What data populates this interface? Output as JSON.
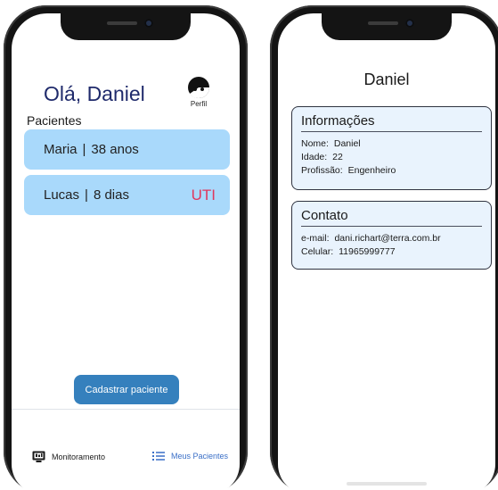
{
  "left_screen": {
    "greeting": "Olá, Daniel",
    "profile_label": "Perfil",
    "section_title": "Pacientes",
    "patients": [
      {
        "name": "Maria",
        "separator": "|",
        "age": "38  anos",
        "tag": ""
      },
      {
        "name": "Lucas",
        "separator": "|",
        "age": "8  dias",
        "tag": "UTI"
      }
    ],
    "register_button": "Cadastrar paciente",
    "nav": {
      "monitoring": {
        "label": "Monitoramento",
        "icon": "monitor-icon"
      },
      "my_patients": {
        "label": "Meus Pacientes",
        "icon": "list-icon"
      }
    }
  },
  "right_screen": {
    "title": "Daniel",
    "info": {
      "title": "Informações",
      "name_label": "Nome:",
      "name_value": "Daniel",
      "age_label": "Idade:",
      "age_value": "22",
      "profession_label": "Profissão:",
      "profession_value": "Engenheiro"
    },
    "contact": {
      "title": "Contato",
      "email_label": "e-mail:",
      "email_value": "dani.richart@terra.com.br",
      "phone_label": "Celular:",
      "phone_value": "11965999777"
    }
  },
  "colors": {
    "greeting": "#1f2a6b",
    "patient_card": "#a9d9fb",
    "uti_tag": "#e0375d",
    "primary_button": "#3580bd",
    "nav_active": "#3a6fc7",
    "info_card_bg": "#e9f3fd"
  }
}
